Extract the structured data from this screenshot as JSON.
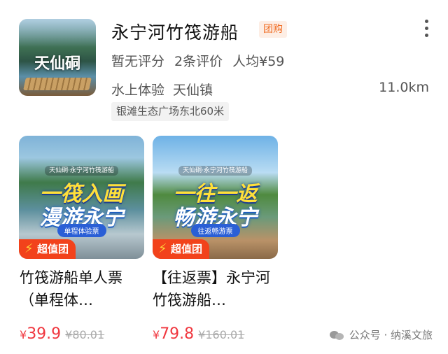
{
  "poi": {
    "title": "永宁河竹筏游船",
    "tag": "团购",
    "thumb_text": "天仙硐",
    "rating": "暂无评分",
    "reviews": "2条评价",
    "avg_price": "人均¥59",
    "category": "水上体验",
    "area": "天仙镇",
    "distance": "11.0km",
    "location_hint": "银滩生态广场东北60米"
  },
  "deals": [
    {
      "banner": "天仙硐·永宁河竹筏游船",
      "headline_1": "一筏入画",
      "headline_2": "漫游永宁",
      "pill": "单程体验票",
      "badge": "超值团",
      "name": "竹筏游船单人票（单程体…",
      "price_currency": "¥",
      "price": "39.9",
      "original_price": "¥80.01"
    },
    {
      "banner": "天仙硐·永宁河竹筏游船",
      "headline_1": "一往一返",
      "headline_2": "畅游永宁",
      "pill": "往返畅游票",
      "badge": "超值团",
      "name": "【往返票】永宁河竹筏游船…",
      "price_currency": "¥",
      "price": "79.8",
      "original_price": "¥160.01"
    }
  ],
  "watermark": "公众号 · 纳溪文旅",
  "colors": {
    "accent": "#f0373f",
    "tag": "#f06a1f",
    "badge": "#f2421b"
  }
}
